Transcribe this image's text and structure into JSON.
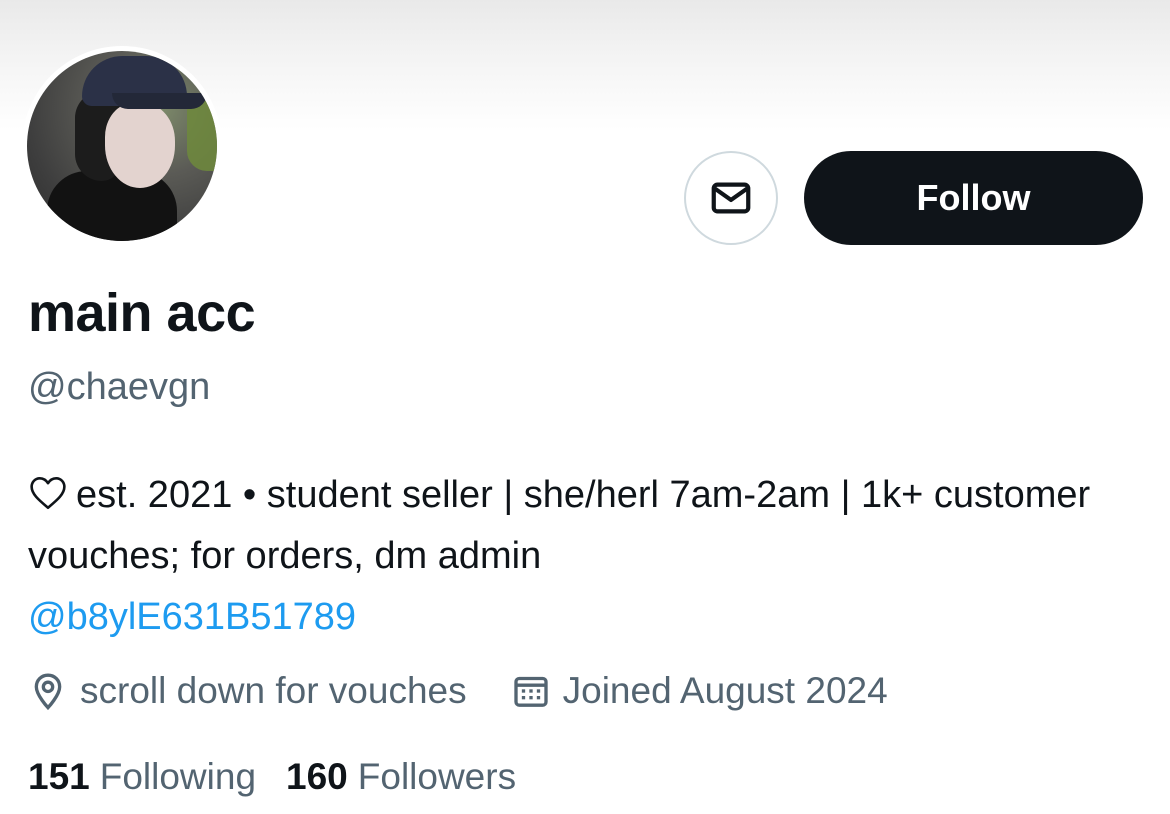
{
  "profile": {
    "display_name": "main acc",
    "handle": "@chaevgn",
    "bio": {
      "icon": "heart-outline-icon",
      "text": "est. 2021 • student seller | she/herl 7am-2am | 1k+ customer vouches; for orders, dm admin",
      "mention": "@b8ylE631B51789"
    },
    "location": "scroll down for vouches",
    "joined": "Joined August 2024"
  },
  "actions": {
    "message_icon": "envelope-icon",
    "follow_label": "Follow"
  },
  "stats": {
    "following_count": "151",
    "following_label": "Following",
    "followers_count": "160",
    "followers_label": "Followers"
  },
  "colors": {
    "text_primary": "#0f1419",
    "text_secondary": "#536471",
    "link": "#1d9bf0",
    "follow_bg": "#0f1419",
    "border": "#cfd9de"
  }
}
